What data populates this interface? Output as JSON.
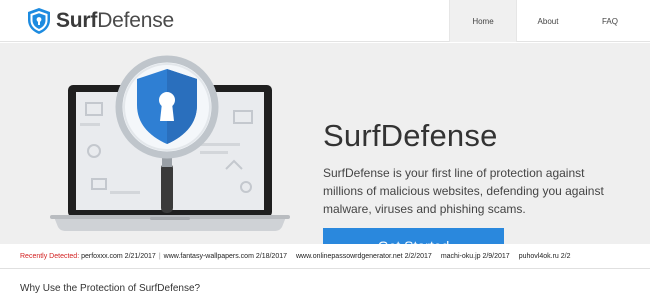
{
  "brand": {
    "name_bold": "Surf",
    "name_rest": "Defense"
  },
  "nav": {
    "home": "Home",
    "about": "About",
    "faq": "FAQ"
  },
  "hero": {
    "title": "SurfDefense",
    "description": "SurfDefense is your first line of protection against millions of malicious websites, defending you against malware, viruses and phishing scams.",
    "cta_label": "Get Started"
  },
  "ticker": {
    "label": "Recently Detected:",
    "items": [
      "perfoxxx.com 2/21/2017",
      "www.fantasy-wallpapers.com 2/18/2017",
      "www.onlinepassowrdgenerator.net 2/2/2017",
      "machi-oku.jp 2/9/2017",
      "puhovl4ok.ru 2/2"
    ]
  },
  "section": {
    "why_heading": "Why Use the Protection of SurfDefense?"
  },
  "colors": {
    "accent": "#2a88dd",
    "alert_red": "#d21f1f",
    "hero_bg": "#efefef"
  },
  "icons": {
    "logo": "shield-lock-icon",
    "hero_art": "laptop-magnifier-shield-icon"
  }
}
